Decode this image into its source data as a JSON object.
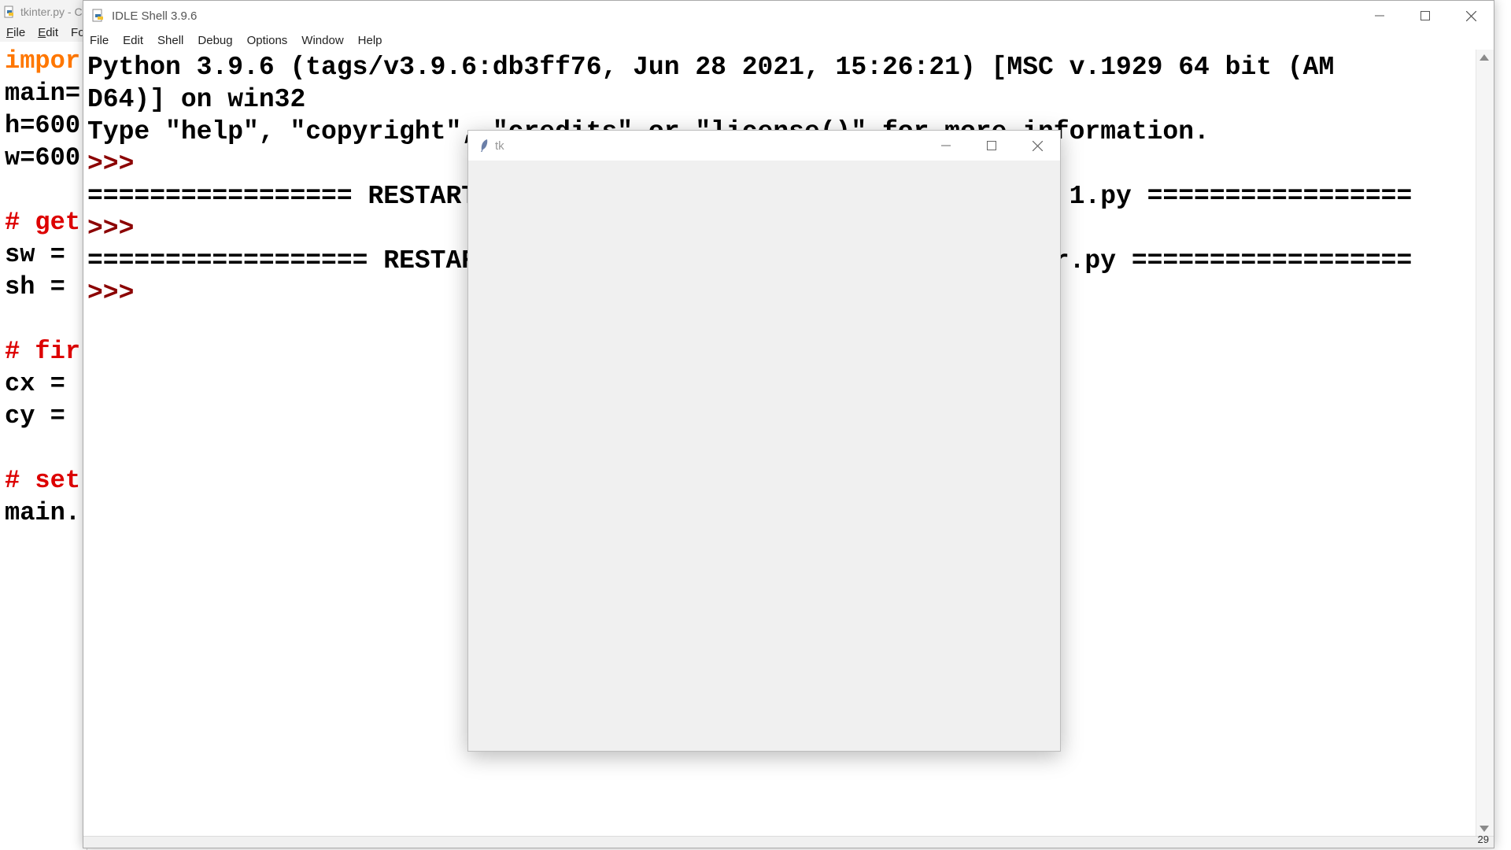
{
  "editor": {
    "title": "tkinter.py - C",
    "menu": [
      "File",
      "Edit",
      "Fo"
    ],
    "code_lines": [
      {
        "text": "impor",
        "style": "kw"
      },
      {
        "text": "main=",
        "style": "plain"
      },
      {
        "text": "h=600",
        "style": "plain"
      },
      {
        "text": "w=600",
        "style": "plain"
      },
      {
        "text": "",
        "style": "plain"
      },
      {
        "text": "# get",
        "style": "cm"
      },
      {
        "text": "sw = ",
        "style": "plain"
      },
      {
        "text": "sh = ",
        "style": "plain"
      },
      {
        "text": "",
        "style": "plain"
      },
      {
        "text": "# fir",
        "style": "cm"
      },
      {
        "text": "cx = ",
        "style": "plain"
      },
      {
        "text": "cy = ",
        "style": "plain"
      },
      {
        "text": "",
        "style": "plain"
      },
      {
        "text": "# set",
        "style": "cm"
      },
      {
        "text": "main.",
        "style": "plain"
      }
    ]
  },
  "shell": {
    "title": "IDLE Shell 3.9.6",
    "menu": [
      "File",
      "Edit",
      "Shell",
      "Debug",
      "Options",
      "Window",
      "Help"
    ],
    "lines": [
      {
        "text": "Python 3.9.6 (tags/v3.9.6:db3ff76, Jun 28 2021, 15:26:21) [MSC v.1929 64 bit (AM",
        "type": "out"
      },
      {
        "text": "D64)] on win32",
        "type": "out"
      },
      {
        "text": "Type \"help\", \"copyright\", \"credits\" or \"license()\" for more information.",
        "type": "out"
      },
      {
        "text": ">>>",
        "type": "prompt"
      },
      {
        "text": "================= RESTART: C:/Users/Programmer/Desktop/tkinter 1.py =================",
        "type": "out"
      },
      {
        "text": ">>>",
        "type": "prompt"
      },
      {
        "text": "================== RESTART: C:/Users/Programmer/Desktop/tkinter.py ==================",
        "type": "out"
      },
      {
        "text": ">>>",
        "type": "prompt"
      }
    ],
    "status_position": "29"
  },
  "tk_window": {
    "title": "tk"
  }
}
